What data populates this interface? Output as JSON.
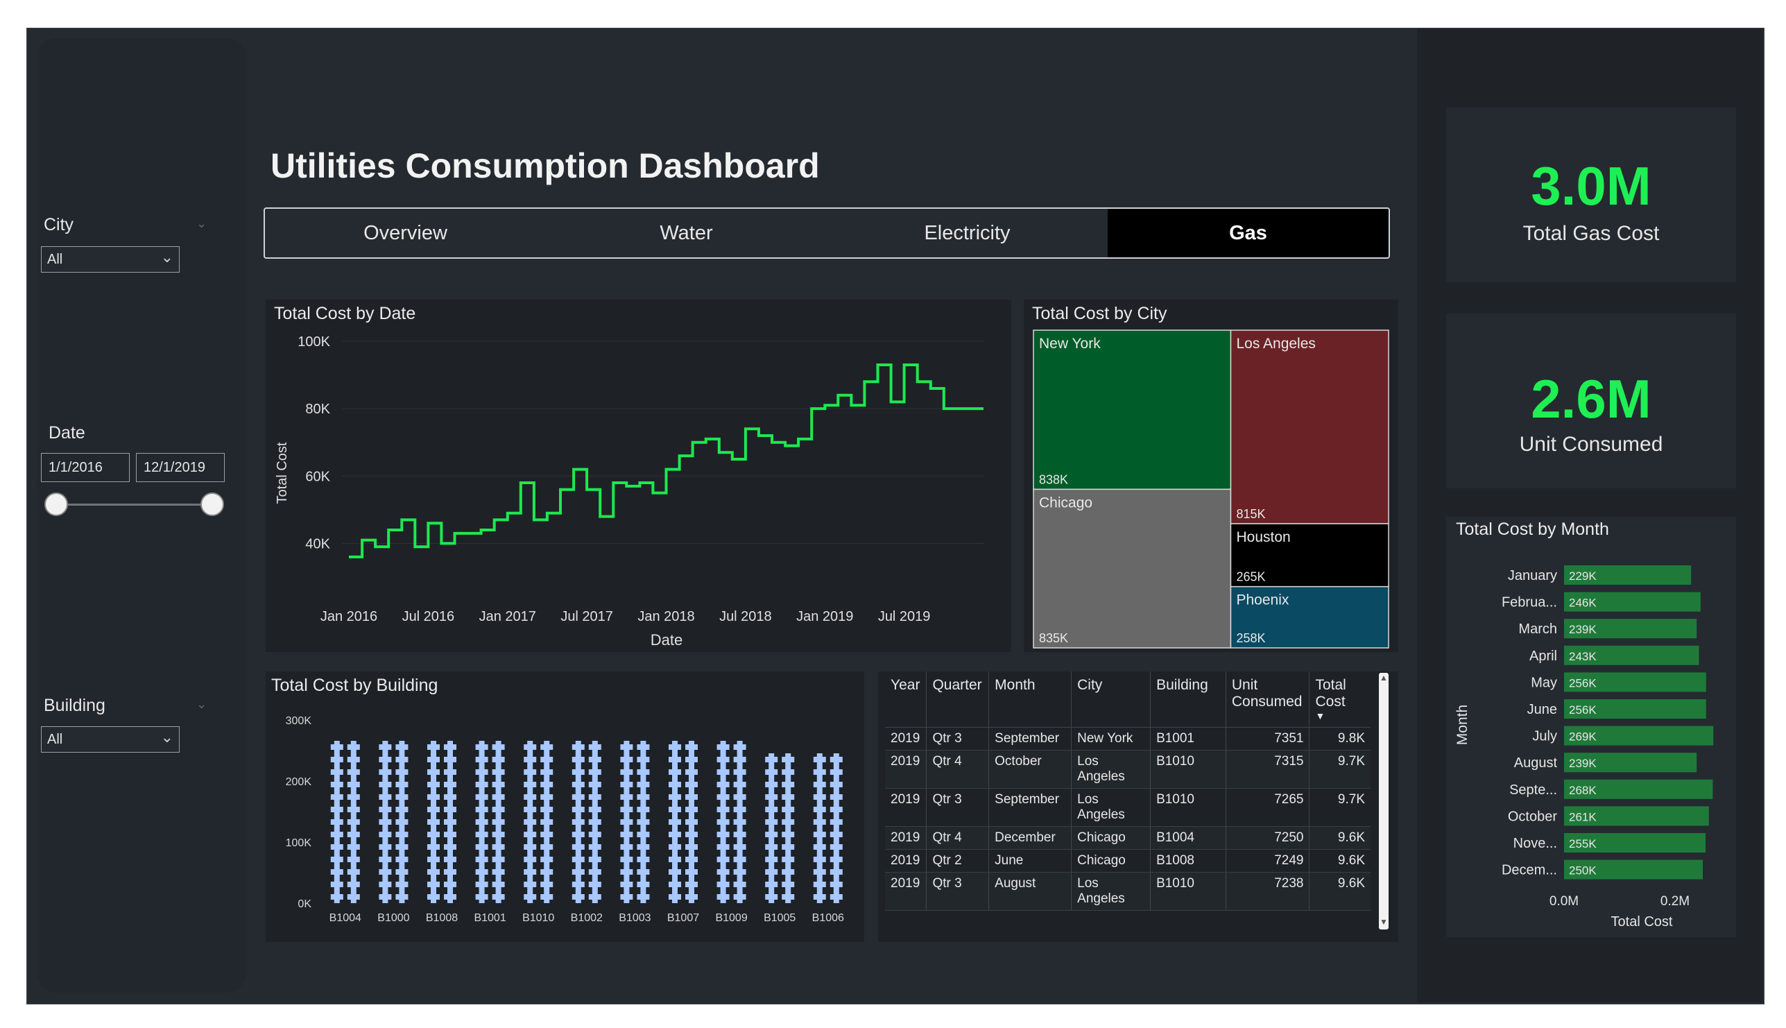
{
  "dashboard": {
    "title": "Utilities Consumption Dashboard"
  },
  "tabs": [
    {
      "label": "Overview"
    },
    {
      "label": "Water"
    },
    {
      "label": "Electricity"
    },
    {
      "label": "Gas"
    }
  ],
  "filters": {
    "city": {
      "label": "City",
      "value": "All"
    },
    "date": {
      "label": "Date",
      "start": "1/1/2016",
      "end": "12/1/2019"
    },
    "building": {
      "label": "Building",
      "value": "All"
    }
  },
  "kpis": {
    "gas_cost": {
      "value": "3.0M",
      "label": "Total Gas Cost"
    },
    "unit_consumed": {
      "value": "2.6M",
      "label": "Unit Consumed"
    }
  },
  "colors": {
    "accent": "#1ef054",
    "line": "#1ee84f",
    "bar": "#1f7a3a",
    "building": "#a8c8ff"
  },
  "cost_by_date": {
    "title": "Total Cost by Date",
    "chart_data": {
      "type": "line",
      "title": "Total Cost by Date",
      "xlabel": "Date",
      "ylabel": "Total Cost",
      "ylim": [
        30000,
        100000
      ],
      "yticks": [
        {
          "v": 40000,
          "label": "40K"
        },
        {
          "v": 60000,
          "label": "60K"
        },
        {
          "v": 80000,
          "label": "80K"
        },
        {
          "v": 100000,
          "label": "100K"
        }
      ],
      "xticks": [
        "Jan 2016",
        "Jul 2016",
        "Jan 2017",
        "Jul 2017",
        "Jan 2018",
        "Jul 2018",
        "Jan 2019",
        "Jul 2019"
      ],
      "x": [
        "2016-01",
        "2016-02",
        "2016-03",
        "2016-04",
        "2016-05",
        "2016-06",
        "2016-07",
        "2016-08",
        "2016-09",
        "2016-10",
        "2016-11",
        "2016-12",
        "2017-01",
        "2017-02",
        "2017-03",
        "2017-04",
        "2017-05",
        "2017-06",
        "2017-07",
        "2017-08",
        "2017-09",
        "2017-10",
        "2017-11",
        "2017-12",
        "2018-01",
        "2018-02",
        "2018-03",
        "2018-04",
        "2018-05",
        "2018-06",
        "2018-07",
        "2018-08",
        "2018-09",
        "2018-10",
        "2018-11",
        "2018-12",
        "2019-01",
        "2019-02",
        "2019-03",
        "2019-04",
        "2019-05",
        "2019-06",
        "2019-07",
        "2019-08",
        "2019-09",
        "2019-10",
        "2019-11",
        "2019-12"
      ],
      "values": [
        36000,
        41000,
        39000,
        44000,
        47000,
        39000,
        46000,
        40000,
        43000,
        43000,
        44000,
        47000,
        49000,
        58000,
        47000,
        49000,
        56000,
        62000,
        56000,
        48000,
        58000,
        57000,
        58000,
        55000,
        62000,
        66000,
        70000,
        71000,
        67000,
        65000,
        74000,
        72000,
        70000,
        69000,
        71000,
        80000,
        81000,
        84000,
        81000,
        88000,
        93000,
        82000,
        93000,
        88000,
        86000,
        80000,
        80000,
        80000
      ]
    }
  },
  "cost_by_city": {
    "title": "Total Cost by City",
    "chart_data": {
      "type": "treemap",
      "items": [
        {
          "name": "New York",
          "value": 838,
          "label": "838K",
          "color": "#005c28"
        },
        {
          "name": "Chicago",
          "value": 835,
          "label": "835K",
          "color": "#686868"
        },
        {
          "name": "Los Angeles",
          "value": 815,
          "label": "815K",
          "color": "#6b2226"
        },
        {
          "name": "Houston",
          "value": 265,
          "label": "265K",
          "color": "#000000"
        },
        {
          "name": "Phoenix",
          "value": 258,
          "label": "258K",
          "color": "#0a4a62"
        }
      ]
    }
  },
  "cost_by_building": {
    "title": "Total Cost by Building",
    "chart_data": {
      "type": "bar",
      "categories": [
        "B1004",
        "B1000",
        "B1008",
        "B1001",
        "B1010",
        "B1002",
        "B1003",
        "B1007",
        "B1009",
        "B1005",
        "B1006"
      ],
      "values": [
        283000,
        282000,
        280000,
        279000,
        278000,
        277000,
        272000,
        266000,
        264000,
        262000,
        253000
      ],
      "yticks": [
        {
          "v": 0,
          "label": "0K"
        },
        {
          "v": 100000,
          "label": "100K"
        },
        {
          "v": 200000,
          "label": "200K"
        },
        {
          "v": 300000,
          "label": "300K"
        }
      ],
      "ylim": [
        0,
        300000
      ]
    }
  },
  "detail_table": {
    "columns": [
      "Year",
      "Quarter",
      "Month",
      "City",
      "Building",
      "Unit Consumed",
      "Total Cost"
    ],
    "rows": [
      [
        "2019",
        "Qtr 3",
        "September",
        "New York",
        "B1001",
        "7351",
        "9.8K"
      ],
      [
        "2019",
        "Qtr 4",
        "October",
        "Los Angeles",
        "B1010",
        "7315",
        "9.7K"
      ],
      [
        "2019",
        "Qtr 3",
        "September",
        "Los Angeles",
        "B1010",
        "7265",
        "9.7K"
      ],
      [
        "2019",
        "Qtr 4",
        "December",
        "Chicago",
        "B1004",
        "7250",
        "9.6K"
      ],
      [
        "2019",
        "Qtr 2",
        "June",
        "Chicago",
        "B1008",
        "7249",
        "9.6K"
      ],
      [
        "2019",
        "Qtr 3",
        "August",
        "Los Angeles",
        "B1010",
        "7238",
        "9.6K"
      ]
    ]
  },
  "cost_by_month": {
    "title": "Total Cost by Month",
    "chart_data": {
      "type": "bar",
      "orientation": "horizontal",
      "ylabel": "Month",
      "xlabel": "Total Cost",
      "xlim": [
        0,
        300000
      ],
      "xticks": [
        {
          "v": 0,
          "label": "0.0M"
        },
        {
          "v": 200000,
          "label": "0.2M"
        }
      ],
      "categories": [
        "January",
        "Februa...",
        "March",
        "April",
        "May",
        "June",
        "July",
        "August",
        "Septe...",
        "October",
        "Nove...",
        "Decem..."
      ],
      "values": [
        229000,
        246000,
        239000,
        243000,
        256000,
        256000,
        269000,
        239000,
        268000,
        261000,
        255000,
        250000
      ],
      "labels": [
        "229K",
        "246K",
        "239K",
        "243K",
        "256K",
        "256K",
        "269K",
        "239K",
        "268K",
        "261K",
        "255K",
        "250K"
      ]
    }
  }
}
